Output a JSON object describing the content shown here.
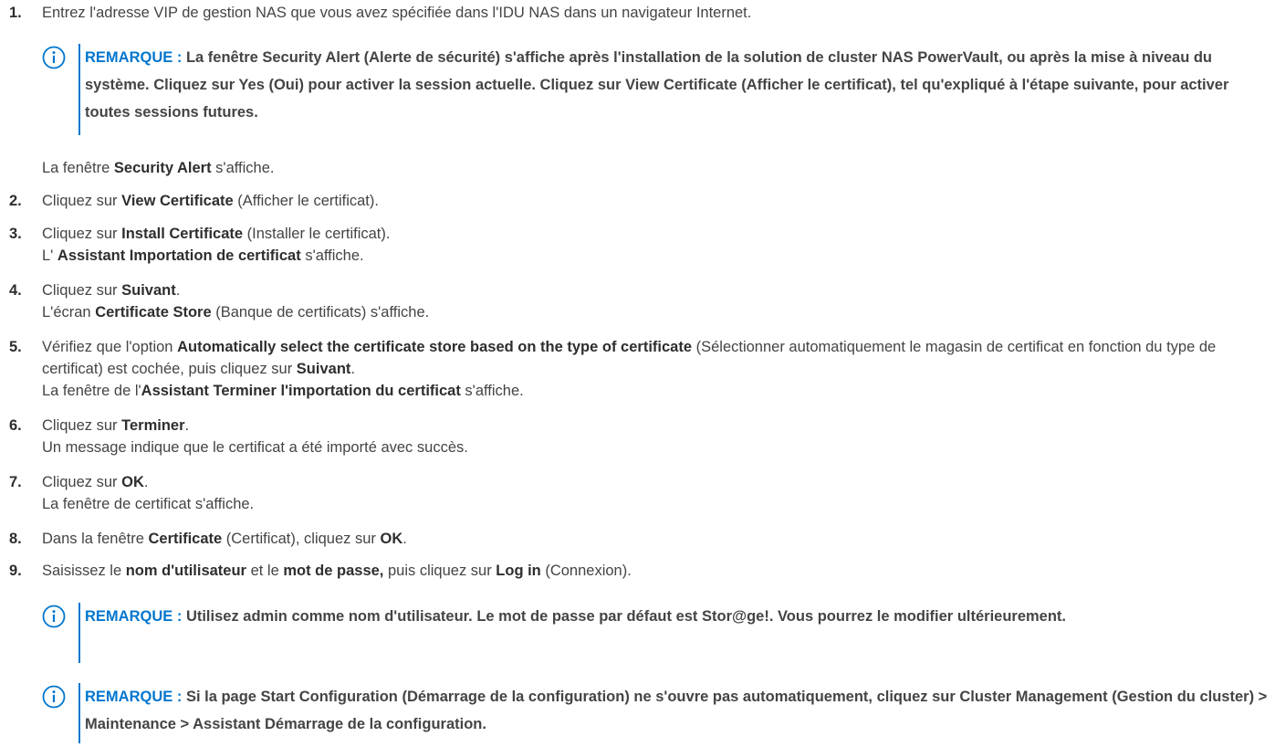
{
  "steps": [
    {
      "n": "1.",
      "parts": [
        {
          "t": "Entrez l'adresse VIP de gestion NAS que vous avez spécifiée dans l'IDU NAS dans un navigateur Internet."
        }
      ]
    },
    {
      "n": "2.",
      "parts": [
        {
          "t": "Cliquez sur "
        },
        {
          "t": "View Certificate",
          "b": true
        },
        {
          "t": " (Afficher le certificat)."
        }
      ]
    },
    {
      "n": "3.",
      "parts": [
        {
          "t": "Cliquez sur "
        },
        {
          "t": "Install Certificate",
          "b": true
        },
        {
          "t": " (Installer le certificat)."
        },
        {
          "br": true
        },
        {
          "t": "L' "
        },
        {
          "t": "Assistant Importation de certificat",
          "b": true
        },
        {
          "t": " s'affiche."
        }
      ]
    },
    {
      "n": "4.",
      "parts": [
        {
          "t": "Cliquez sur "
        },
        {
          "t": "Suivant",
          "b": true
        },
        {
          "t": "."
        },
        {
          "br": true
        },
        {
          "t": "L'écran "
        },
        {
          "t": "Certificate Store",
          "b": true
        },
        {
          "t": " (Banque de certificats) s'affiche."
        }
      ]
    },
    {
      "n": "5.",
      "parts": [
        {
          "t": "Vérifiez que l'option "
        },
        {
          "t": "Automatically select the certificate store based on the type of certificate",
          "b": true
        },
        {
          "t": " (Sélectionner automatiquement le magasin de certificat en fonction du type de certificat) est cochée, puis cliquez sur "
        },
        {
          "t": "Suivant",
          "b": true
        },
        {
          "t": "."
        },
        {
          "br": true
        },
        {
          "t": "La fenêtre de l'"
        },
        {
          "t": "Assistant Terminer l'importation du certificat",
          "b": true
        },
        {
          "t": " s'affiche."
        }
      ]
    },
    {
      "n": "6.",
      "parts": [
        {
          "t": "Cliquez sur "
        },
        {
          "t": "Terminer",
          "b": true
        },
        {
          "t": "."
        },
        {
          "br": true
        },
        {
          "t": "Un message indique que le certificat a été importé avec succès."
        }
      ]
    },
    {
      "n": "7.",
      "parts": [
        {
          "t": "Cliquez sur "
        },
        {
          "t": "OK",
          "b": true
        },
        {
          "t": "."
        },
        {
          "br": true
        },
        {
          "t": "La fenêtre de certificat s'affiche."
        }
      ]
    },
    {
      "n": "8.",
      "parts": [
        {
          "t": "Dans la fenêtre "
        },
        {
          "t": "Certificate",
          "b": true
        },
        {
          "t": " (Certificat), cliquez sur "
        },
        {
          "t": "OK",
          "b": true
        },
        {
          "t": "."
        }
      ]
    },
    {
      "n": "9.",
      "parts": [
        {
          "t": "Saisissez le "
        },
        {
          "t": "nom d'utilisateur",
          "b": true
        },
        {
          "t": " et le "
        },
        {
          "t": "mot de passe,",
          "b": true
        },
        {
          "t": " puis cliquez sur "
        },
        {
          "t": "Log in",
          "b": true
        },
        {
          "t": " (Connexion)."
        }
      ]
    }
  ],
  "after_note_1": [
    {
      "t": "La fenêtre "
    },
    {
      "t": "Security Alert",
      "b": true
    },
    {
      "t": " s'affiche."
    }
  ],
  "notes": [
    {
      "label": "REMARQUE :",
      "text": "La fenêtre Security Alert (Alerte de sécurité) s'affiche après l'installation de la solution de cluster NAS PowerVault, ou après la mise à niveau du système. Cliquez sur Yes (Oui) pour activer la session actuelle. Cliquez sur View Certificate (Afficher le certificat), tel qu'expliqué à l'étape suivante, pour activer toutes sessions futures."
    },
    {
      "label": "REMARQUE :",
      "text": "Utilisez admin comme nom d'utilisateur. Le mot de passe par défaut est Stor@ge!. Vous pourrez le modifier ultérieurement."
    },
    {
      "label": "REMARQUE :",
      "text": "Si la page Start Configuration (Démarrage de la configuration) ne s'ouvre pas automatiquement, cliquez sur Cluster Management (Gestion du cluster) > Maintenance > Assistant Démarrage de la configuration."
    }
  ],
  "icons": {
    "note": "info-circle-icon"
  },
  "colors": {
    "accent": "#0076ce",
    "text": "#444444"
  }
}
